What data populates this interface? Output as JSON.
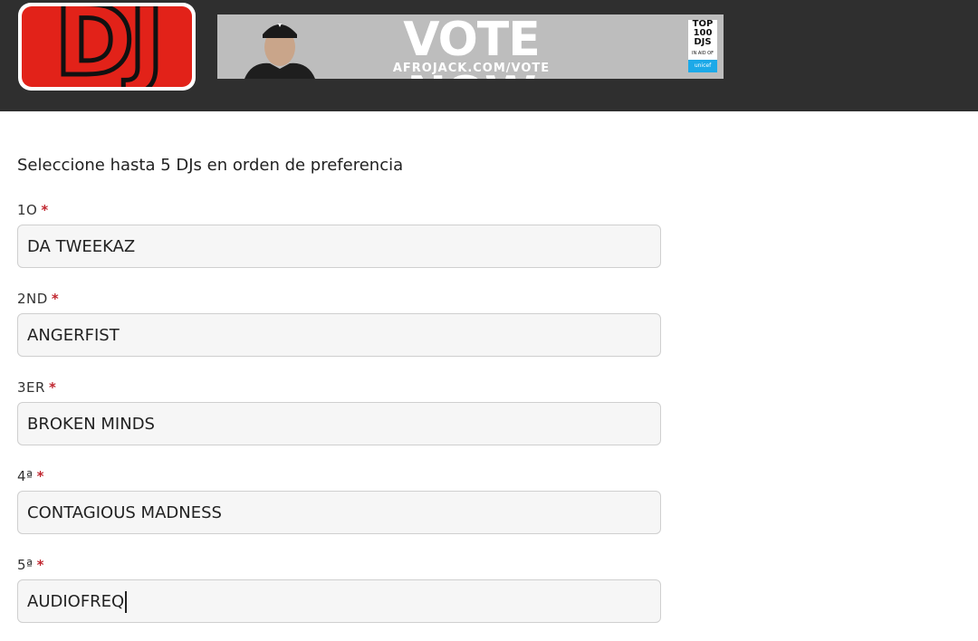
{
  "header": {
    "logo_text": "DJ",
    "banner": {
      "headline": "VOTE NOW",
      "url": "AFROJACK.COM/VOTE",
      "badge_top": "TOP 100 DJS",
      "badge_sub": "IN AID OF",
      "badge_partner": "unicef"
    },
    "colors": {
      "header_bg": "#2f2f2f",
      "brand_red": "#e22219",
      "required": "#c0262f"
    }
  },
  "form": {
    "instruction": "Seleccione hasta 5 DJs en orden de preferencia",
    "required_mark": "*",
    "questions": [
      {
        "label": "1O",
        "value": "DA TWEEKAZ"
      },
      {
        "label": "2ND",
        "value": "ANGERFIST"
      },
      {
        "label": "3ER",
        "value": "BROKEN MINDS"
      },
      {
        "label": "4ª",
        "value": "CONTAGIOUS MADNESS"
      },
      {
        "label": "5ª",
        "value": "AUDIOFREQ"
      }
    ]
  }
}
